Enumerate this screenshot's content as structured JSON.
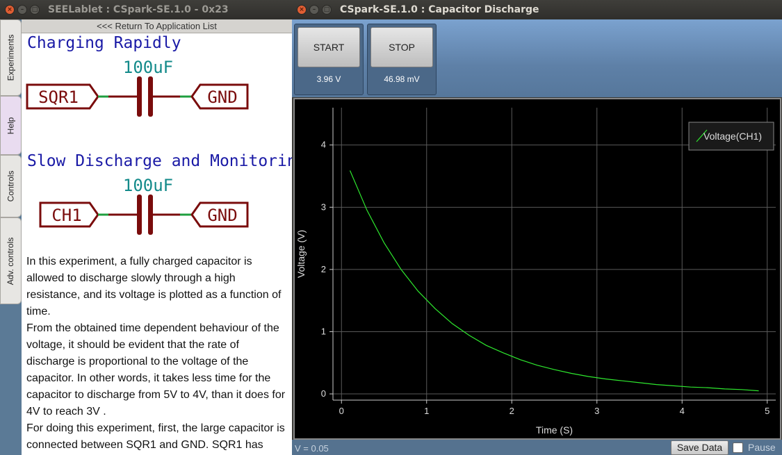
{
  "left_window": {
    "title": "SEELablet : CSpark-SE.1.0 - 0x23",
    "tabs": [
      "Experiments",
      "Help",
      "Controls",
      "Adv. controls"
    ],
    "back_link": "<<< Return To Application List",
    "help": {
      "heading1": "Charging Rapidly",
      "heading2": "Slow Discharge and Monitoring",
      "circuit1": {
        "left": "SQR1",
        "cap": "100uF",
        "right": "GND"
      },
      "circuit2": {
        "left": "CH1",
        "cap": "100uF",
        "right": "GND"
      },
      "paragraphs": [
        "In this experiment, a fully charged capacitor is allowed to discharge slowly through a high resistance, and its voltage is plotted as a function of time.",
        "From the obtained time dependent behaviour of the voltage, it should be evident that the rate of discharge is proportional to the voltage of the capacitor. In other words, it takes less time for the capacitor to discharge from 5V to 4V, than it does for 4V to reach 3V .",
        "For doing this experiment, first, the large capacitor is connected between SQR1 and GND. SQR1 has"
      ]
    }
  },
  "right_window": {
    "title": "CSpark-SE.1.0 : Capacitor Discharge",
    "controls": [
      {
        "label": "START",
        "value": "3.96  V"
      },
      {
        "label": "STOP",
        "value": "46.98 mV"
      }
    ],
    "status": "V = 0.05",
    "save_label": "Save Data",
    "pause_label": "Pause"
  },
  "colors": {
    "curve": "#2ee82e",
    "plot_bg": "#000000",
    "circuit": "#7a0c0c",
    "wire": "#1f9f3f",
    "heading": "#1a1aa6",
    "cap_label": "#138a8a"
  },
  "chart_data": {
    "type": "line",
    "title": "",
    "xlabel": "Time (S)",
    "ylabel": "Voltage (V)",
    "xlim": [
      -0.1,
      5.1
    ],
    "ylim": [
      -0.1,
      4.6
    ],
    "xticks": [
      0,
      1,
      2,
      3,
      4,
      5
    ],
    "yticks": [
      0,
      1,
      2,
      3,
      4
    ],
    "grid": true,
    "legend_position": "top-right",
    "series": [
      {
        "name": "Voltage(CH1)",
        "color": "#2ee82e",
        "x": [
          0.1,
          0.3,
          0.5,
          0.7,
          0.9,
          1.1,
          1.3,
          1.5,
          1.7,
          1.9,
          2.1,
          2.3,
          2.5,
          2.7,
          2.9,
          3.1,
          3.3,
          3.5,
          3.7,
          3.9,
          4.1,
          4.3,
          4.5,
          4.7,
          4.9
        ],
        "y": [
          3.59,
          2.95,
          2.43,
          2.0,
          1.65,
          1.37,
          1.13,
          0.94,
          0.78,
          0.66,
          0.55,
          0.46,
          0.39,
          0.33,
          0.28,
          0.24,
          0.21,
          0.18,
          0.15,
          0.13,
          0.11,
          0.1,
          0.08,
          0.07,
          0.05
        ]
      }
    ]
  }
}
